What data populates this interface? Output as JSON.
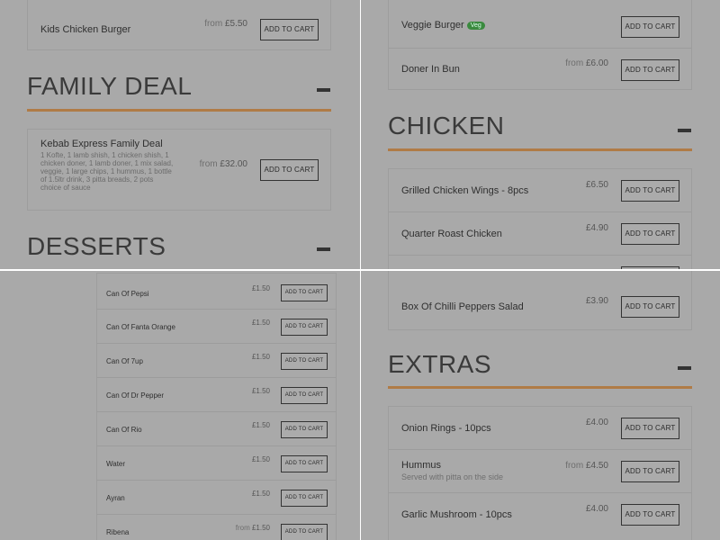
{
  "button_label": "ADD TO CART",
  "tl": {
    "kids_row": {
      "name": "Kids Chicken Burger",
      "price_prefix": "from",
      "price": "£5.50"
    },
    "family_heading": "FAMILY DEAL",
    "family_item": {
      "name": "Kebab Express Family Deal",
      "description": "1 Kofte, 1 lamb shish, 1 chicken shish, 1 chicken doner, 1 lamb doner, 1 mix salad, veggie, 1 large chips, 1 hummus, 1 bottle of 1.5ltr drink, 3 pitta breads, 2 pots choice of sauce",
      "price_prefix": "from",
      "price": "£32.00"
    },
    "desserts_heading": "DESSERTS"
  },
  "tr": {
    "items": [
      {
        "name": "Veggie Burger",
        "badge": "Veg",
        "price_prefix": "",
        "price": ""
      },
      {
        "name": "Doner In Bun",
        "badge": "",
        "price_prefix": "from",
        "price": "£6.00"
      }
    ],
    "chicken_heading": "CHICKEN",
    "chicken_items": [
      {
        "name": "Grilled Chicken Wings - 8pcs",
        "price": "£6.50"
      },
      {
        "name": "Quarter Roast Chicken",
        "price": "£4.90"
      }
    ]
  },
  "bl": {
    "drinks": [
      {
        "name": "Can Of Pepsi",
        "price_prefix": "",
        "price": "£1.50"
      },
      {
        "name": "Can Of Fanta Orange",
        "price_prefix": "",
        "price": "£1.50"
      },
      {
        "name": "Can Of 7up",
        "price_prefix": "",
        "price": "£1.50"
      },
      {
        "name": "Can Of Dr Pepper",
        "price_prefix": "",
        "price": "£1.50"
      },
      {
        "name": "Can Of Rio",
        "price_prefix": "",
        "price": "£1.50"
      },
      {
        "name": "Water",
        "price_prefix": "",
        "price": "£1.50"
      },
      {
        "name": "Ayran",
        "price_prefix": "",
        "price": "£1.50"
      },
      {
        "name": "Ribena",
        "price_prefix": "from",
        "price": "£1.50"
      }
    ]
  },
  "br": {
    "salad_item": {
      "name": "Box Of Chilli Peppers Salad",
      "price": "£3.90"
    },
    "extras_heading": "EXTRAS",
    "extras": [
      {
        "name": "Onion Rings - 10pcs",
        "sub": "",
        "price_prefix": "",
        "price": "£4.00"
      },
      {
        "name": "Hummus",
        "sub": "Served with pitta on the side",
        "price_prefix": "from",
        "price": "£4.50"
      },
      {
        "name": "Garlic Mushroom - 10pcs",
        "sub": "",
        "price_prefix": "",
        "price": "£4.00"
      }
    ]
  }
}
